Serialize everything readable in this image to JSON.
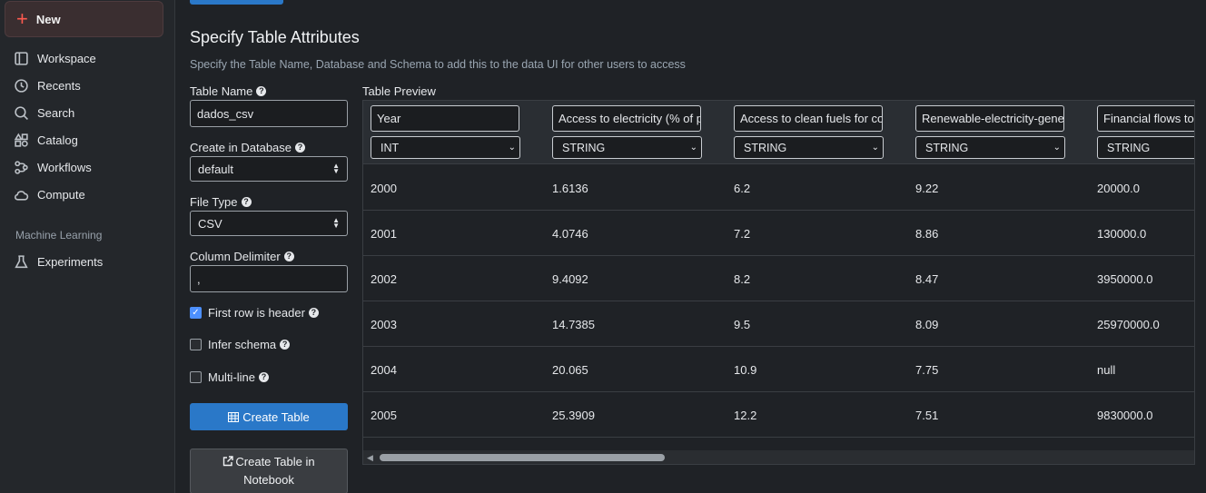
{
  "sidebar": {
    "new_label": "New",
    "items": [
      {
        "label": "Workspace",
        "icon": "workspace-icon"
      },
      {
        "label": "Recents",
        "icon": "clock-icon"
      },
      {
        "label": "Search",
        "icon": "search-icon"
      },
      {
        "label": "Catalog",
        "icon": "catalog-icon"
      },
      {
        "label": "Workflows",
        "icon": "workflows-icon"
      },
      {
        "label": "Compute",
        "icon": "cloud-icon"
      }
    ],
    "section_ml": "Machine Learning",
    "ml_items": [
      {
        "label": "Experiments",
        "icon": "flask-icon"
      }
    ]
  },
  "form": {
    "title": "Specify Table Attributes",
    "subtitle": "Specify the Table Name, Database and Schema to add this to the data UI for other users to access",
    "table_name_label": "Table Name",
    "table_name_value": "dados_csv",
    "database_label": "Create in Database",
    "database_value": "default",
    "file_type_label": "File Type",
    "file_type_value": "CSV",
    "delimiter_label": "Column Delimiter",
    "delimiter_value": ",",
    "first_row_header_label": "First row is header",
    "first_row_header_checked": true,
    "infer_schema_label": "Infer schema",
    "infer_schema_checked": false,
    "multiline_label": "Multi-line",
    "multiline_checked": false,
    "create_table_label": "Create Table",
    "create_table_notebook_line1": "Create Table in",
    "create_table_notebook_line2": "Notebook"
  },
  "preview": {
    "label": "Table Preview",
    "columns": [
      {
        "name": "Year",
        "type": "INT"
      },
      {
        "name": "Access to electricity (% of p",
        "type": "STRING"
      },
      {
        "name": "Access to clean fuels for co",
        "type": "STRING"
      },
      {
        "name": "Renewable-electricity-gene",
        "type": "STRING"
      },
      {
        "name": "Financial flows to",
        "type": "STRING"
      }
    ],
    "rows": [
      [
        "2000",
        "1.6136",
        "6.2",
        "9.22",
        "20000.0"
      ],
      [
        "2001",
        "4.0746",
        "7.2",
        "8.86",
        "130000.0"
      ],
      [
        "2002",
        "9.4092",
        "8.2",
        "8.47",
        "3950000.0"
      ],
      [
        "2003",
        "14.7385",
        "9.5",
        "8.09",
        "25970000.0"
      ],
      [
        "2004",
        "20.065",
        "10.9",
        "7.75",
        "null"
      ],
      [
        "2005",
        "25.3909",
        "12.2",
        "7.51",
        "9830000.0"
      ]
    ]
  },
  "colors": {
    "primary": "#2a78c8",
    "new_accent": "#ff5a4f",
    "checkbox": "#4d90fe"
  }
}
